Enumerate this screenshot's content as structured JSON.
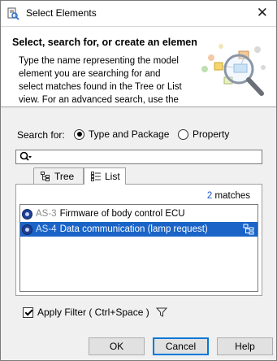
{
  "window": {
    "title": "Select Elements",
    "close_icon": "close-icon"
  },
  "header": {
    "title": "Select, search for, or create an elemen",
    "description": "Type the name representing the model element you are searching for and select matches found in the Tree or List view. For an advanced search, use the",
    "art_icon": "magnifier-diagram-icon"
  },
  "search": {
    "label": "Search for:",
    "options": [
      "Type and Package",
      "Property"
    ],
    "selected": "Type and Package",
    "input_value": "",
    "icon": "search-icon"
  },
  "tabs": [
    {
      "label": "Tree",
      "icon": "tree-icon",
      "active": false
    },
    {
      "label": "List",
      "icon": "list-icon",
      "active": true
    }
  ],
  "results": {
    "count": "2",
    "count_suffix": "matches",
    "items": [
      {
        "id": "AS-3",
        "name": "Firmware of body control ECU",
        "selected": false
      },
      {
        "id": "AS-4",
        "name": "Data communication (lamp request)",
        "selected": true
      }
    ]
  },
  "filter": {
    "label": "Apply Filter ( Ctrl+Space )",
    "checked": true,
    "icon": "filter-icon"
  },
  "buttons": {
    "ok": "OK",
    "cancel": "Cancel",
    "help": "Help"
  },
  "colors": {
    "selection": "#1a64c8",
    "count_accent": "#1a55c8",
    "default_button_border": "#0078d7"
  }
}
